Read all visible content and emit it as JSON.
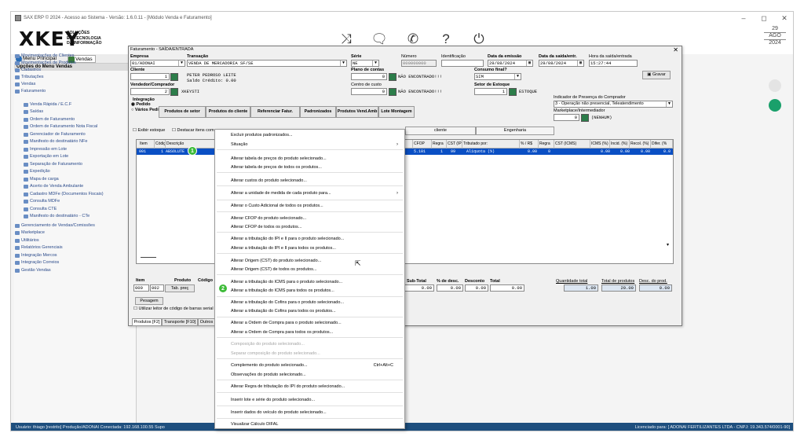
{
  "window": {
    "title": "SAX ERP © 2024 - Acesso ao Sistema - Versão: 1.6.0.11 - [Módulo Venda e Faturamento]",
    "controls": [
      "–",
      "◻",
      "✕"
    ]
  },
  "header": {
    "logo_text": "XKEY",
    "logo_sub": [
      "SOLUÇÕES",
      "EM TECNOLOGIA",
      "DA INFORMAÇÃO"
    ],
    "icons": [
      "shuffle-icon",
      "chat-icon",
      "whatsapp-icon",
      "help-icon",
      "power-icon"
    ],
    "date": {
      "day": "29",
      "month": "AGO",
      "year": "2024"
    }
  },
  "sidebar": {
    "tabs": [
      "Menu Principal",
      "Vendas"
    ],
    "title": "Opções do Menu Vendas",
    "items": [
      {
        "label": "Movimentações de Clientes",
        "level": 0
      },
      {
        "label": "Movimentações de Produtos",
        "level": 0
      },
      {
        "label": "Cadastros",
        "level": 0
      },
      {
        "label": "Tributações",
        "level": 0
      },
      {
        "label": "Vendas",
        "level": 0
      },
      {
        "label": "Faturamento",
        "level": 0
      },
      {
        "label": "Venda Rápida / E.C.F",
        "level": 1
      },
      {
        "label": "Saídas",
        "level": 1
      },
      {
        "label": "Ordem de Faturamento",
        "level": 1
      },
      {
        "label": "Ordem de Faturamento Nota Fiscal",
        "level": 1
      },
      {
        "label": "Gerenciador de Faturamento",
        "level": 1
      },
      {
        "label": "Manifesto do destinatário NFe",
        "level": 1
      },
      {
        "label": "Impressão em Lote",
        "level": 1
      },
      {
        "label": "Exportação em Lote",
        "level": 1
      },
      {
        "label": "Separação de Faturamento",
        "level": 1
      },
      {
        "label": "Expedição",
        "level": 1
      },
      {
        "label": "Mapa de carga",
        "level": 1
      },
      {
        "label": "Acerto de Venda Ambulante",
        "level": 1
      },
      {
        "label": "Cadastro MDFe (Documentos Fiscais)",
        "level": 1
      },
      {
        "label": "Consulta MDFe",
        "level": 1
      },
      {
        "label": "Consulta CTE",
        "level": 1
      },
      {
        "label": "Manifesto do destinatário - CTe",
        "level": 1
      },
      {
        "label": "Gerenciamento de Vendas/Comissões",
        "level": 0
      },
      {
        "label": "Marketplace",
        "level": 0
      },
      {
        "label": "Utilitários",
        "level": 0
      },
      {
        "label": "Relatórios Gerenciais",
        "level": 0
      },
      {
        "label": "Integração Mercos",
        "level": 0
      },
      {
        "label": "Integração Correios",
        "level": 0
      },
      {
        "label": "Gestão Vendas",
        "level": 0
      }
    ]
  },
  "dialog": {
    "title": "Faturamento - SAÍDA/ENTRADA",
    "close": "✕",
    "empresa_label": "Empresa",
    "empresa_value": "01/ADONAI",
    "transacao_label": "Transação",
    "transacao_value": "VENDA DE MERCADORIA SF/SE",
    "serie_label": "Série",
    "serie_value": "NE",
    "numero_label": "Número",
    "numero_value": "000000000",
    "identificacao_label": "Identificação",
    "data_emissao_label": "Data da emissão",
    "data_emissao_value": "29/08/2024",
    "data_saida_label": "Data da saída/entr.",
    "data_saida_value": "29/08/2024",
    "hora_saida_label": "Hora da saída/entrada",
    "hora_saida_value": "15:27:44",
    "gravar_label": "Gravar",
    "cliente_label": "Cliente",
    "cliente_code": "1",
    "cliente_name": "PETER PEDROSO LEITE",
    "cliente_credit": "Saldo Crédito: 0.00",
    "plano_label": "Plano de contas",
    "plano_code": "0",
    "plano_name": "NÃO ENCONTRADO!!!",
    "consumo_label": "Consumo final?",
    "consumo_value": "SIM",
    "vendedor_label": "Vendedor/Comprador",
    "vendedor_code": "2",
    "vendedor_name": "XKEYSTI",
    "centro_label": "Centro de custo",
    "centro_code": "0",
    "centro_name": "NÃO ENCONTRADO!!!",
    "setor_label": "Setor de Estoque",
    "setor_code": "1",
    "setor_name": "ESTOQUE",
    "integracao_label": "Integração",
    "radio_pedido": "Pedido",
    "radio_varios": "Vários Pedidos",
    "toolbar_buttons": [
      "Produtos de setor",
      "Produtos do cliente",
      "Referenciar Fatur.",
      "Padronizados",
      "Produtos Vend.Amb",
      "Lote Montagem"
    ],
    "indicador_label": "Indicador de Presença do Comprador",
    "indicador_value": "3 - Operação não presencial, Teleatendimento",
    "marketplace_label": "Marketplace/Intermediador",
    "marketplace_code": "0",
    "marketplace_value": "(NENHUM)",
    "exibir_estoque": "Exibir estoque",
    "destacar_itens": "Destacar itens com",
    "tab_cliente": "cliente",
    "tab_engenharia": "Engenharia",
    "grid": {
      "headers": [
        "Item",
        "Código",
        "Descrição",
        "CFOP",
        "Regra",
        "CST (IPI)",
        "Tributado por:",
        "% / R$",
        "Regra",
        "CST (ICMS)",
        "ICMS (%)",
        "Incid. (%)",
        "Recol. (%)",
        "Difer. (%"
      ],
      "row": {
        "item": "001",
        "codigo": "1",
        "descricao": "ABSOLUTE TEST",
        "cfop": "5.101",
        "regra": "1",
        "cst_ipi": "99",
        "tributado": "Alíquota (%)",
        "perc": "0.00",
        "regra2": "0",
        "icms": "0.00",
        "incid": "0.00",
        "recol": "0.00",
        "difer": "0.0"
      }
    },
    "bottom": {
      "item_label": "Item",
      "produto_label": "Produto",
      "codigo_label": "Código",
      "item_value": "000",
      "produto_value": "002",
      "tab_preco": "Tab. preç",
      "pesagem": "Pesagem",
      "leitor": "Utilizar leitor de código de barras serial",
      "tabs": [
        "Produtos [F2]",
        "Transporte [F10]",
        "Outros"
      ],
      "subtotal_label": "Sub-Total",
      "subtotal_value": "0.00",
      "desc_label": "% de desc.",
      "desc_value": "0.00",
      "desconto_label": "Desconto",
      "desconto_value": "0.00",
      "total_label": "Total",
      "total_value": "0.00",
      "quantidade_label": "Quantidade total",
      "quantidade_value": "1.00",
      "total_produtos_label": "Total de produtos",
      "total_produtos_value": "20.00",
      "desc_prod_label": "Desc. do prod.",
      "desc_prod_value": "0.00"
    }
  },
  "context_menu": {
    "items": [
      {
        "label": "Excluir produtos padronizados...",
        "disabled": false
      },
      {
        "label": "Situação",
        "disabled": false,
        "submenu": true
      },
      {
        "sep": true
      },
      {
        "label": "Alterar tabela de preços do produto selecionado...",
        "disabled": false
      },
      {
        "label": "Alterar tabela de preços de todos os produtos...",
        "disabled": false
      },
      {
        "sep": true
      },
      {
        "label": "Alterar custos do produto selecionado...",
        "disabled": false
      },
      {
        "sep": true
      },
      {
        "label": "Alterar a unidade de medida de cada produto para...",
        "disabled": false,
        "submenu": true
      },
      {
        "sep": true
      },
      {
        "label": "Alterar o Custo Adicional de todos os produtos...",
        "disabled": false
      },
      {
        "sep": true
      },
      {
        "label": "Alterar CFOP do produto selecionado...",
        "disabled": false
      },
      {
        "label": "Alterar CFOP de todos os produtos...",
        "disabled": false
      },
      {
        "sep": true
      },
      {
        "label": "Alterar a tributação do IPI e II para o produto selecionado...",
        "disabled": false
      },
      {
        "label": "Alterar a tributação do IPI e II para todos os produtos...",
        "disabled": false
      },
      {
        "sep": true
      },
      {
        "label": "Alterar Origem (CST) do produto selecionado...",
        "disabled": false
      },
      {
        "label": "Alterar Origem (CST) de todos os produtos...",
        "disabled": false
      },
      {
        "sep": true
      },
      {
        "label": "Alterar a tributação do ICMS para o produto selecionado...",
        "disabled": false
      },
      {
        "label": "Alterar a tributação do ICMS para todos os produtos...",
        "disabled": false
      },
      {
        "sep": true
      },
      {
        "label": "Alterar a tributação do Cofins para o produto selecionado...",
        "disabled": false
      },
      {
        "label": "Alterar a tributação do Cofins para todos os produtos...",
        "disabled": false
      },
      {
        "sep": true
      },
      {
        "label": "Alterar a Ordem de Compra para o produto selecionado...",
        "disabled": false
      },
      {
        "label": "Alterar a Ordem de Compra para todos os produtos...",
        "disabled": false
      },
      {
        "sep": true
      },
      {
        "label": "Composição do produto selecionado...",
        "disabled": true
      },
      {
        "label": "Separar composição do produto selecionado...",
        "disabled": true
      },
      {
        "sep": true
      },
      {
        "label": "Complemento do produto selecionado...",
        "disabled": false,
        "shortcut": "Ctrl+Alt+C"
      },
      {
        "label": "Observações do produto selecionado...",
        "disabled": false
      },
      {
        "sep": true
      },
      {
        "label": "Alterar Regra de tributação do IPI  do produto selecionado...",
        "disabled": false
      },
      {
        "sep": true
      },
      {
        "label": "Inserir lote e série do produto selecionado...",
        "disabled": false
      },
      {
        "sep": true
      },
      {
        "label": "Inserir dados do veículo do produto selecionado...",
        "disabled": false
      },
      {
        "sep": true
      },
      {
        "label": "Visualizar Cálculo DIFAL",
        "disabled": false
      }
    ]
  },
  "annotations": {
    "badge1": "1",
    "badge2": "2"
  },
  "statusbar": {
    "left": "Usuário: thiago [restrito]     Produção/ADONAI     Conectada: 192.168.100.55   Supo",
    "right": "Licenciado para: [ ADONAI FERTILIZANTES LTDA - CNPJ: 19.343.574/0001-90]"
  },
  "colors": {
    "accent": "#3dbb38",
    "selection": "#0a4fc4",
    "statusbar": "#1e4f7e",
    "widget_green": "#1aa06b"
  }
}
